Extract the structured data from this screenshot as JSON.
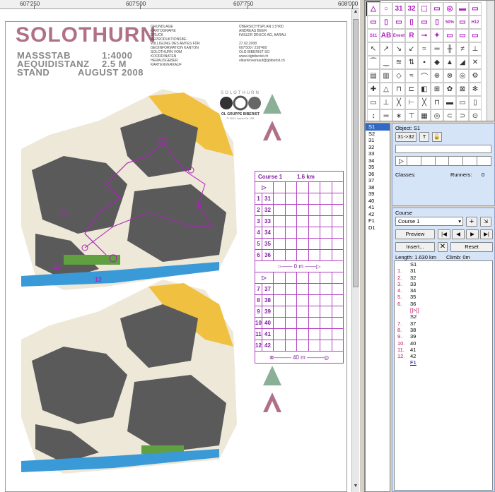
{
  "ruler": {
    "labels": [
      "607'250",
      "607'500",
      "607'750",
      "608'000"
    ]
  },
  "map": {
    "title": "SOLOTHURN",
    "meta": [
      {
        "label": "MASSSTAB",
        "value": "1:4000"
      },
      {
        "label": "AEQUIDISTANZ",
        "value": "2.5 M"
      },
      {
        "label": "STAND",
        "value": "AUGUST 2008"
      }
    ],
    "legend_left": "GRUNDLAGE\nKARTOGRAFIE\nDRUCK\nREPRODUKTIONSBE-\nWILLIGUNG DES AMTES FÜR\nGEOINFORMATION KANTON\nSOLOTHURN VOM\nKOORDINATEN\nHERAUSGEBER\nKARTENVERKAUF",
    "legend_right": "ÜBERSICHTSPLAN 1:5'000\nANDREAS BEER\nFASLER DRUCK AG, AARAU\n\n27.02.2008\n607'500 / 228'400\nOLG BIBERIST SO\nwww.olgbiberist.ch\nolkartenverkauf@gbiberist.ch",
    "logo_top": "SOLOTHURN",
    "logo_bottom": "OL GRUPPE BIBERIST",
    "logo_caption": "© 2014 Lizenz Nr 155",
    "course_labels": [
      "11",
      "12"
    ]
  },
  "course_table": {
    "name": "Course 1",
    "length": "1.6 km",
    "rows_part1": [
      {
        "n": "1",
        "code": "31"
      },
      {
        "n": "2",
        "code": "32"
      },
      {
        "n": "3",
        "code": "33"
      },
      {
        "n": "4",
        "code": "34"
      },
      {
        "n": "5",
        "code": "35"
      },
      {
        "n": "6",
        "code": "36"
      }
    ],
    "mid_label": "0 m",
    "rows_part2": [
      {
        "n": "7",
        "code": "37"
      },
      {
        "n": "8",
        "code": "38"
      },
      {
        "n": "9",
        "code": "39"
      },
      {
        "n": "10",
        "code": "40"
      },
      {
        "n": "11",
        "code": "41"
      },
      {
        "n": "12",
        "code": "42"
      }
    ],
    "finish_label": "40 m"
  },
  "symbols": {
    "row1": [
      "△",
      "○",
      "31",
      "32",
      "⬚",
      "▭",
      "◎",
      "▬",
      "▭"
    ],
    "row2": [
      "▭",
      "▯",
      "▭",
      "▯",
      "▭",
      "▯",
      "50%",
      "▭",
      "H12"
    ],
    "row3": [
      "S11",
      "AB",
      "Event",
      "R",
      "⊸",
      "✦",
      "▭",
      "▭",
      "▭"
    ]
  },
  "object_list": [
    "S1",
    "S2",
    "31",
    "32",
    "33",
    "34",
    "35",
    "36",
    "37",
    "38",
    "39",
    "40",
    "41",
    "42",
    "F1",
    "D1"
  ],
  "object_panel": {
    "label": "Object: S1",
    "btn_route": "31->32",
    "btn_t": "T",
    "classes_label": "Classes:",
    "runners_label": "Runners:",
    "runners_value": "0"
  },
  "course_panel": {
    "label": "Course",
    "selected_course": "Course 1",
    "preview": "Preview",
    "insert": "Insert...",
    "reset": "Reset",
    "length": "Length: 1.630 km",
    "climb": "Climb: 0m",
    "items": [
      {
        "num": "",
        "code": "S1"
      },
      {
        "num": "1.",
        "code": "31"
      },
      {
        "num": "2.",
        "code": "32"
      },
      {
        "num": "3.",
        "code": "33"
      },
      {
        "num": "4.",
        "code": "34"
      },
      {
        "num": "5.",
        "code": "35"
      },
      {
        "num": "6.",
        "code": "36"
      },
      {
        "num": "",
        "code": "[]>[]"
      },
      {
        "num": "",
        "code": "S2"
      },
      {
        "num": "7.",
        "code": "37"
      },
      {
        "num": "8.",
        "code": "38"
      },
      {
        "num": "9.",
        "code": "39"
      },
      {
        "num": "10.",
        "code": "40"
      },
      {
        "num": "11.",
        "code": "41"
      },
      {
        "num": "12.",
        "code": "42"
      },
      {
        "num": "",
        "code": "F1"
      }
    ]
  },
  "colors": {
    "accent": "#b020c0",
    "selection": "#316ac5",
    "title": "#b07088",
    "map_building": "#5a5a5a",
    "map_water": "#3a9ad8",
    "map_yellow": "#f0c040",
    "map_green": "#60a040"
  }
}
